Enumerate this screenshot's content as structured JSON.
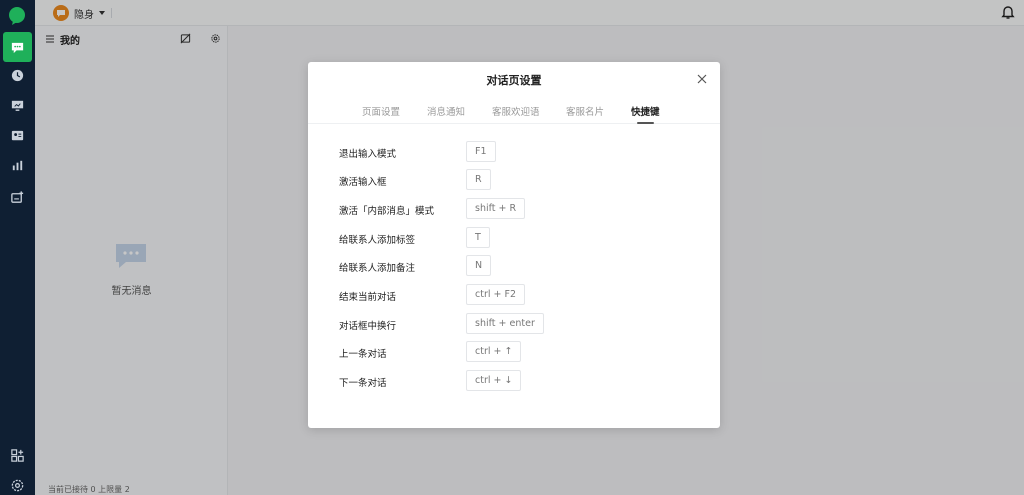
{
  "topbar": {
    "status_label": "隐身"
  },
  "panel": {
    "title": "我的",
    "empty_text": "暂无消息",
    "footer": "当前已接待 0 上限量 2"
  },
  "modal": {
    "title": "对话页设置",
    "tabs": [
      {
        "label": "页面设置",
        "active": false
      },
      {
        "label": "消息通知",
        "active": false
      },
      {
        "label": "客服欢迎语",
        "active": false
      },
      {
        "label": "客服名片",
        "active": false
      },
      {
        "label": "快捷键",
        "active": true
      }
    ],
    "shortcuts": [
      {
        "name": "退出输入模式",
        "key": "F1"
      },
      {
        "name": "激活输入框",
        "key": "R"
      },
      {
        "name": "激活「内部消息」模式",
        "key": "shift + R"
      },
      {
        "name": "给联系人添加标签",
        "key": "T"
      },
      {
        "name": "给联系人添加备注",
        "key": "N"
      },
      {
        "name": "结束当前对话",
        "key": "ctrl + F2"
      },
      {
        "name": "对话框中换行",
        "key": "shift + enter"
      },
      {
        "name": "上一条对话",
        "key": "ctrl + ↑"
      },
      {
        "name": "下一条对话",
        "key": "ctrl + ↓"
      }
    ]
  },
  "colors": {
    "rail_bg": "#0f1f33",
    "accent_green": "#1fb05a",
    "status_orange": "#ee8b1f"
  },
  "icons": {
    "rail": [
      "chat-icon",
      "history-icon",
      "monitor-icon",
      "contact-card-icon",
      "stats-icon",
      "add-ticket-icon",
      "apps-icon",
      "settings-icon"
    ]
  }
}
